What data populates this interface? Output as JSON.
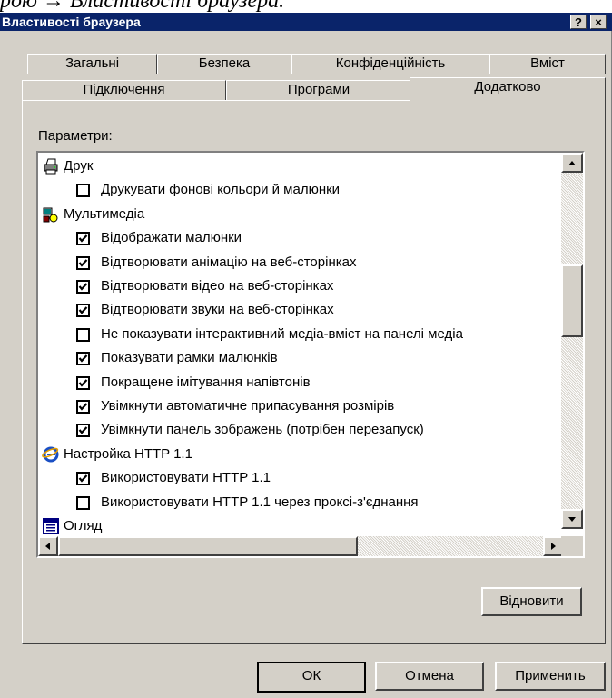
{
  "caption": "рою → Властивості браузера.",
  "window": {
    "title": "Властивості браузера",
    "help_label": "?",
    "close_label": "×"
  },
  "tabs_row1": [
    "Загальні",
    "Безпека",
    "Конфіденційність",
    "Вміст"
  ],
  "tabs_row2": [
    "Підключення",
    "Програми",
    "Додатково"
  ],
  "active_tab": "Додатково",
  "settings_label": "Параметри:",
  "settings": [
    {
      "type": "category",
      "icon": "printer-icon",
      "label": "Друк"
    },
    {
      "type": "option",
      "checked": false,
      "label": "Друкувати фонові кольори й малюнки"
    },
    {
      "type": "category",
      "icon": "multimedia-icon",
      "label": "Мультимедіа"
    },
    {
      "type": "option",
      "checked": true,
      "label": "Відображати малюнки"
    },
    {
      "type": "option",
      "checked": true,
      "label": "Відтворювати анімацію на веб-сторінках"
    },
    {
      "type": "option",
      "checked": true,
      "label": "Відтворювати відео на веб-сторінках"
    },
    {
      "type": "option",
      "checked": true,
      "label": "Відтворювати звуки на веб-сторінках"
    },
    {
      "type": "option",
      "checked": false,
      "label": "Не показувати інтерактивний медіа-вміст на панелі медіа"
    },
    {
      "type": "option",
      "checked": true,
      "label": "Показувати рамки малюнків"
    },
    {
      "type": "option",
      "checked": true,
      "label": "Покращене імітування напівтонів"
    },
    {
      "type": "option",
      "checked": true,
      "label": "Увімкнути автоматичне припасування розмірів"
    },
    {
      "type": "option",
      "checked": true,
      "label": "Увімкнути панель зображень (потрібен перезапуск)"
    },
    {
      "type": "category",
      "icon": "internet-explorer-icon",
      "label": "Настройка HTTP 1.1"
    },
    {
      "type": "option",
      "checked": true,
      "label": "Використовувати HTTP 1.1"
    },
    {
      "type": "option",
      "checked": false,
      "label": "Використовувати HTTP 1.1 через проксі-з'єднання"
    },
    {
      "type": "category",
      "icon": "browse-icon",
      "label": "Огляд"
    }
  ],
  "buttons": {
    "restore": "Відновити",
    "ok": "ОК",
    "cancel": "Отмена",
    "apply": "Применить"
  },
  "colors": {
    "titlebar": "#0a246a",
    "face": "#d4d0c8"
  }
}
